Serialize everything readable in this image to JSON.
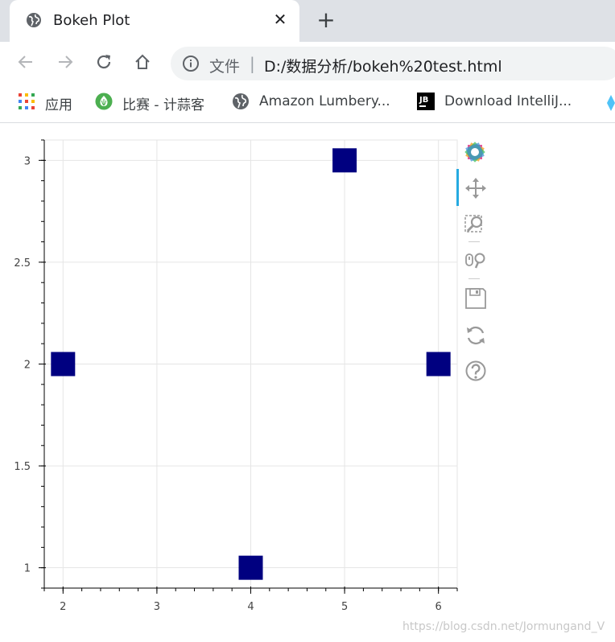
{
  "browser": {
    "tab": {
      "title": "Bokeh Plot",
      "icon": "globe-icon"
    },
    "omnibox": {
      "security_label": "文件",
      "url": "D:/数据分析/bokeh%20test.html"
    },
    "bookmarks": [
      {
        "label": "应用",
        "icon": "apps-grid-icon"
      },
      {
        "label": "比赛 - 计蒜客",
        "icon": "garlic-logo-icon"
      },
      {
        "label": "Amazon Lumbery...",
        "icon": "globe-icon"
      },
      {
        "label": "Download IntelliJ...",
        "icon": "jetbrains-logo-icon"
      }
    ]
  },
  "bokeh_toolbar": {
    "tools": [
      {
        "name": "bokeh-logo-icon"
      },
      {
        "name": "pan-tool-icon",
        "active": true
      },
      {
        "name": "box-zoom-tool-icon"
      },
      {
        "name": "wheel-zoom-tool-icon"
      },
      {
        "name": "save-tool-icon"
      },
      {
        "name": "reset-tool-icon"
      },
      {
        "name": "help-tool-icon"
      }
    ]
  },
  "chart_data": {
    "type": "scatter",
    "marker": "square",
    "color": "#000080",
    "x": [
      2,
      4,
      5,
      6
    ],
    "y": [
      2,
      1,
      3,
      2
    ],
    "xlim": [
      1.8,
      6.2
    ],
    "ylim": [
      0.9,
      3.1
    ],
    "x_ticks": [
      "2",
      "3",
      "4",
      "5",
      "6"
    ],
    "y_ticks": [
      "1",
      "1.5",
      "2",
      "2.5",
      "3"
    ],
    "grid": true
  },
  "watermark": "https://blog.csdn.net/Jormungand_V"
}
